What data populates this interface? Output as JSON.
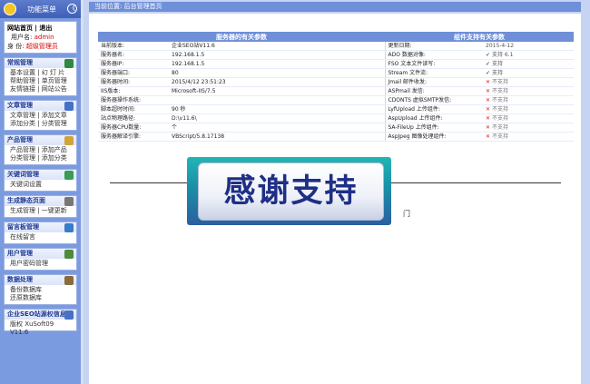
{
  "sidebar": {
    "title": "功能菜单",
    "collapse_label": "《",
    "user": {
      "links": "网站首页 | 退出",
      "username_label": "用户名:",
      "username": "admin",
      "role_label": "身 份:",
      "role": "超级管理员"
    },
    "groups": [
      {
        "title": "常规管理",
        "icon": "settings-icon",
        "items": [
          "基本设置 | 幻 灯 片",
          "帮助管理 | 单页管理",
          "友情链接 | 网站公告"
        ]
      },
      {
        "title": "文章管理",
        "icon": "document-icon",
        "items": [
          "文章管理 | 添加文章",
          "添加分类 | 分类管理"
        ]
      },
      {
        "title": "产品管理",
        "icon": "product-icon",
        "items": [
          "产品管理 | 添加产品",
          "分类管理 | 添加分类"
        ]
      },
      {
        "title": "关键词管理",
        "icon": "keyword-icon",
        "items": [
          "关键词设置"
        ]
      },
      {
        "title": "生成静态页面",
        "icon": "tools-icon",
        "items": [
          "生成管理 | 一键更新"
        ]
      },
      {
        "title": "留言板管理",
        "icon": "search-icon",
        "items": [
          "在线留言"
        ]
      },
      {
        "title": "用户管理",
        "icon": "user-icon",
        "items": [
          "用户密码管理"
        ]
      },
      {
        "title": "数据处理",
        "icon": "database-icon",
        "items": [
          "备份数据库",
          "还原数据库"
        ]
      },
      {
        "title": "企业SEO站源权信息",
        "icon": "info-icon",
        "items": [
          "版权 XuSoft09 V11.6"
        ]
      }
    ]
  },
  "main": {
    "breadcrumb": "当前位置: 后台管理首页",
    "left_header": "服务器的有关参数",
    "right_header": "组件支持有关参数",
    "rows": [
      {
        "l_label": "当前版本:",
        "l_value": "企业SEO站V11.6",
        "r_label": "更新日期:",
        "r_mark": "",
        "r_value": "2015-4-12"
      },
      {
        "l_label": "服务器名:",
        "l_value": "192.168.1.5",
        "r_label": "ADO 数据对像:",
        "r_mark": "✓",
        "r_value": "支持 6.1"
      },
      {
        "l_label": "服务器IP:",
        "l_value": "192.168.1.5",
        "r_label": "FSO 文本文件读写:",
        "r_mark": "✓",
        "r_value": "支持"
      },
      {
        "l_label": "服务器端口:",
        "l_value": "80",
        "r_label": "Stream 文件流:",
        "r_mark": "✓",
        "r_value": "支持"
      },
      {
        "l_label": "服务器时间:",
        "l_value": "2015/4/12 23:51:23",
        "r_label": "Jmail 邮件收发:",
        "r_mark": "✕",
        "r_value": "不支持"
      },
      {
        "l_label": "IIS版本:",
        "l_value": "Microsoft-IIS/7.5",
        "r_label": "ASPmail 发信:",
        "r_mark": "✕",
        "r_value": "不支持"
      },
      {
        "l_label": "服务器操作系统:",
        "l_value": "",
        "r_label": "CDONTS 虚拟SMTP发信:",
        "r_mark": "✕",
        "r_value": "不支持"
      },
      {
        "l_label": "脚本超时时间:",
        "l_value": "90 秒",
        "r_label": "LyfUpload 上传组件:",
        "r_mark": "✕",
        "r_value": "不支持"
      },
      {
        "l_label": "站点物理路径:",
        "l_value": "D:\\v11.6\\",
        "r_label": "AspUpload 上传组件:",
        "r_mark": "✕",
        "r_value": "不支持"
      },
      {
        "l_label": "服务器CPU数量:",
        "l_value": "个",
        "r_label": "SA-FileUp 上传组件:",
        "r_mark": "✕",
        "r_value": "不支持"
      },
      {
        "l_label": "服务器解译引擎:",
        "l_value": "VBScript/5.8.17138",
        "r_label": "AspJpeg 图像处理组件:",
        "r_mark": "✕",
        "r_value": "不支持"
      }
    ],
    "banner_text": "感谢支持",
    "footer_fragment": "门"
  }
}
